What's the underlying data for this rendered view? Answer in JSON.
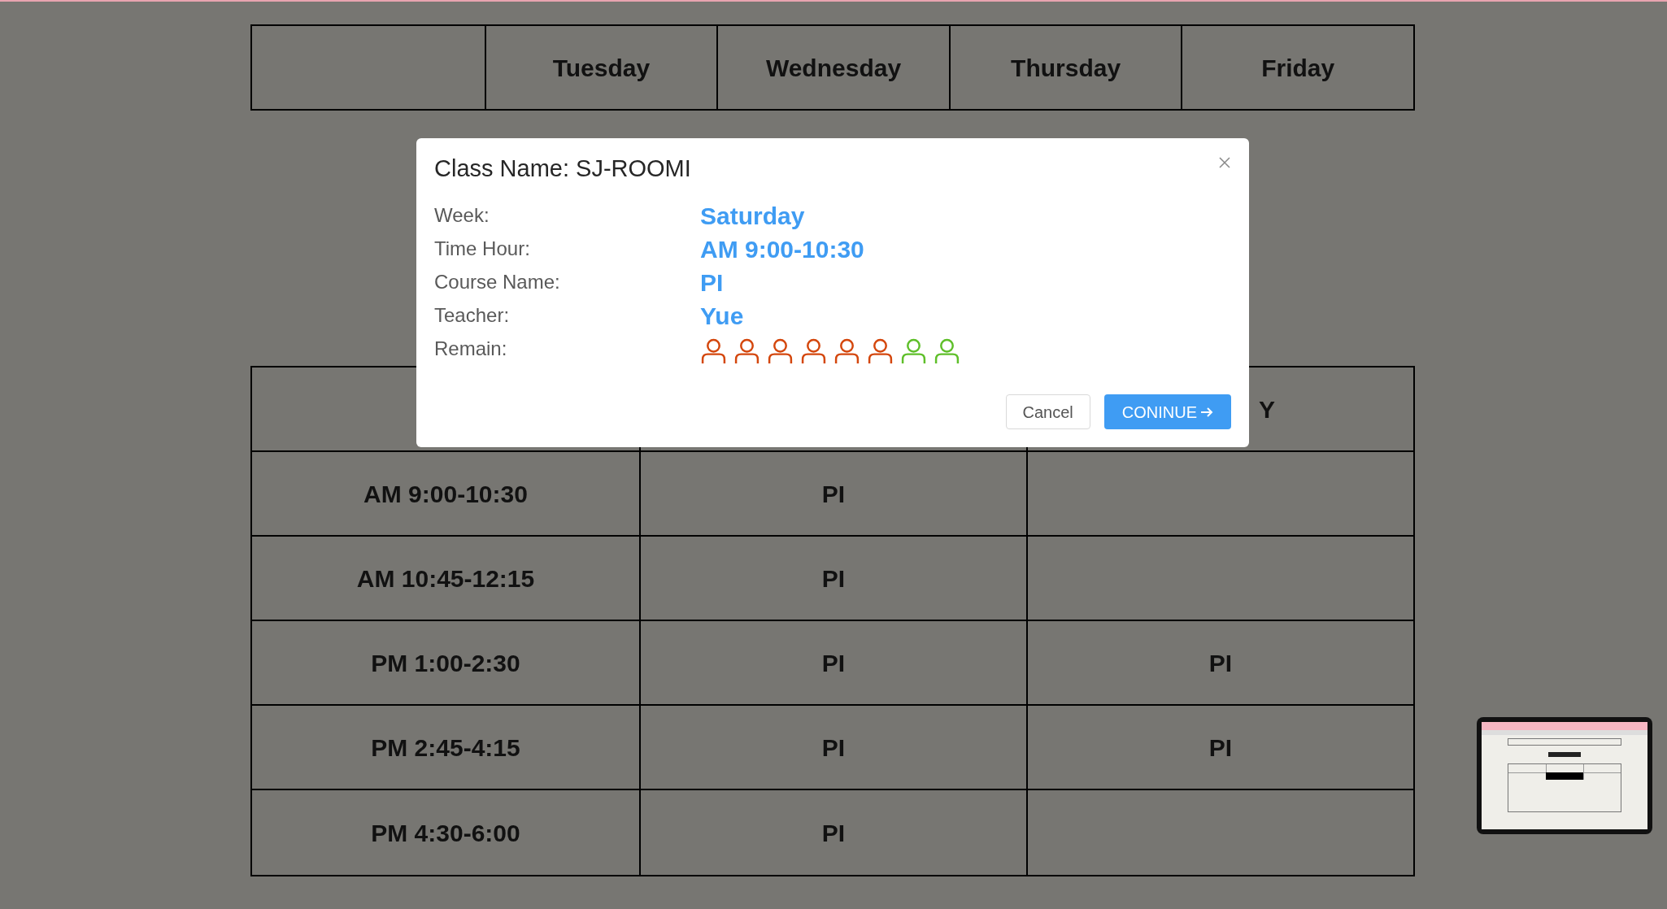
{
  "weekday_header": [
    "Tuesday",
    "Wednesday",
    "Thursday",
    "Friday"
  ],
  "schedule": {
    "header_column_3": "Y",
    "rows": [
      {
        "time": "AM 9:00-10:30",
        "column_2": "PI"
      },
      {
        "time": "AM 10:45-12:15",
        "column_2": "PI"
      },
      {
        "time": "PM 1:00-2:30",
        "column_2": "PI",
        "column_3": "PI"
      },
      {
        "time": "PM 2:45-4:15",
        "column_2": "PI",
        "column_3": "PI"
      },
      {
        "time": "PM 4:30-6:00",
        "column_2": "PI"
      }
    ]
  },
  "dialog": {
    "title": "Class Name: SJ-ROOMI",
    "fields": [
      {
        "label": "Week:",
        "value": "Saturday"
      },
      {
        "label": "Time Hour:",
        "value": "AM 9:00-10:30"
      },
      {
        "label": "Course Name:",
        "value": "PI"
      },
      {
        "label": "Teacher:",
        "value": "Yue"
      }
    ],
    "remain_label": "Remain:",
    "seats": [
      {
        "color": "#d4470d"
      },
      {
        "color": "#d4470d"
      },
      {
        "color": "#d4470d"
      },
      {
        "color": "#d4470d"
      },
      {
        "color": "#d4470d"
      },
      {
        "color": "#d4470d"
      },
      {
        "color": "#5fbf2a"
      },
      {
        "color": "#5fbf2a"
      }
    ],
    "buttons": [
      {
        "label": "Cancel",
        "kind": "secondary"
      },
      {
        "label": "CONINUE",
        "kind": "primary"
      }
    ]
  }
}
